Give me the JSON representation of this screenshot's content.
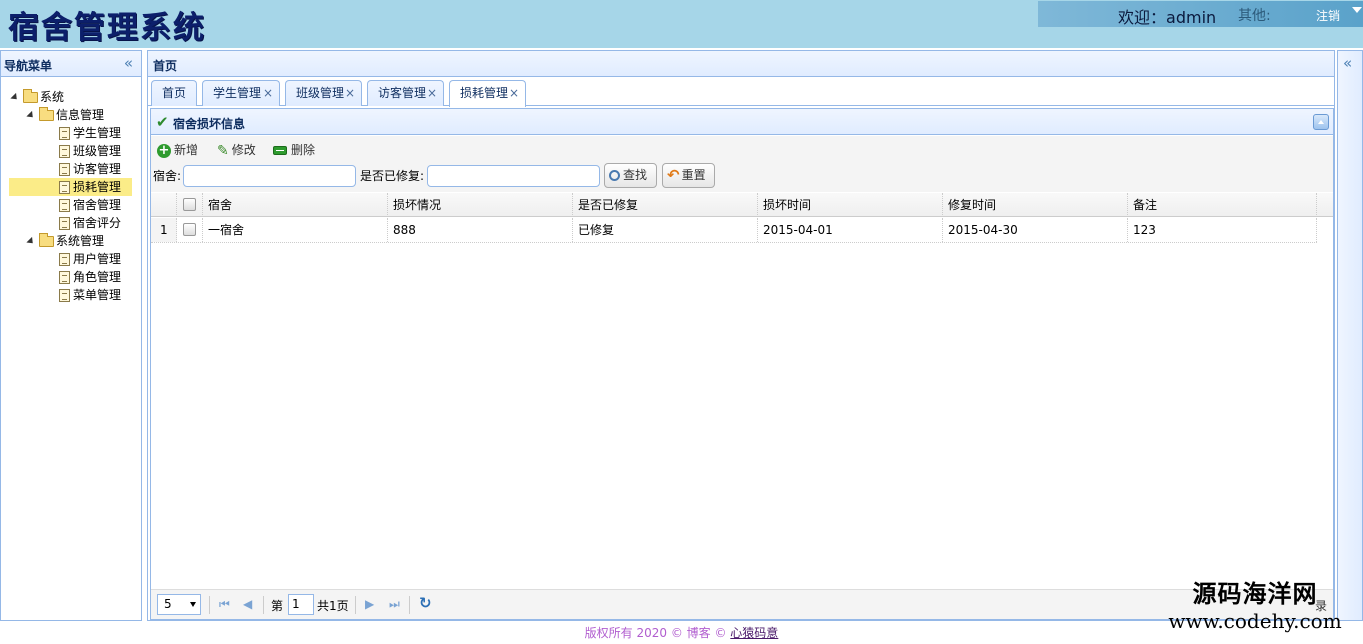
{
  "header": {
    "app_title": "宿舍管理系统",
    "welcome_prefix": "欢迎：",
    "username": "admin",
    "other_label": "其他:",
    "logout": "注销"
  },
  "nav": {
    "title": "导航菜单",
    "tree": [
      {
        "label": "系统",
        "type": "folder",
        "level": 0,
        "expanded": true
      },
      {
        "label": "信息管理",
        "type": "folder",
        "level": 1,
        "expanded": true
      },
      {
        "label": "学生管理",
        "type": "file",
        "level": 2
      },
      {
        "label": "班级管理",
        "type": "file",
        "level": 2
      },
      {
        "label": "访客管理",
        "type": "file",
        "level": 2
      },
      {
        "label": "损耗管理",
        "type": "file",
        "level": 2,
        "selected": true
      },
      {
        "label": "宿舍管理",
        "type": "file",
        "level": 2
      },
      {
        "label": "宿舍评分",
        "type": "file",
        "level": 2
      },
      {
        "label": "系统管理",
        "type": "folder",
        "level": 1,
        "expanded": true
      },
      {
        "label": "用户管理",
        "type": "file",
        "level": 2
      },
      {
        "label": "角色管理",
        "type": "file",
        "level": 2
      },
      {
        "label": "菜单管理",
        "type": "file",
        "level": 2
      }
    ]
  },
  "main": {
    "title": "首页",
    "tabs": [
      {
        "label": "首页",
        "closable": false
      },
      {
        "label": "学生管理",
        "closable": true
      },
      {
        "label": "班级管理",
        "closable": true
      },
      {
        "label": "访客管理",
        "closable": true
      },
      {
        "label": "损耗管理",
        "closable": true,
        "active": true
      }
    ],
    "close_glyph": "×"
  },
  "panel": {
    "title": "宿舍损坏信息",
    "toolbar": {
      "add": "新增",
      "edit": "修改",
      "delete": "删除"
    },
    "search": {
      "dorm_label": "宿舍:",
      "dorm_value": "",
      "repaired_label": "是否已修复:",
      "repaired_value": "",
      "search_button": "查找",
      "reset_button": "重置"
    }
  },
  "grid": {
    "columns": [
      "宿舍",
      "损坏情况",
      "是否已修复",
      "损坏时间",
      "修复时间",
      "备注"
    ],
    "rows": [
      {
        "index": "1",
        "cells": [
          "一宿舍",
          "888",
          "已修复",
          "2015-04-01",
          "2015-04-30",
          "123"
        ]
      }
    ]
  },
  "pager": {
    "page_size": "5",
    "page_prefix": "第",
    "page_number": "1",
    "page_suffix": "共1页",
    "info": "录"
  },
  "footer": {
    "text": "版权所有 2020 © 博客 © ",
    "link": "心猿码意"
  },
  "watermark": {
    "cn": "源码海洋网",
    "url": "www.codehy.com"
  }
}
